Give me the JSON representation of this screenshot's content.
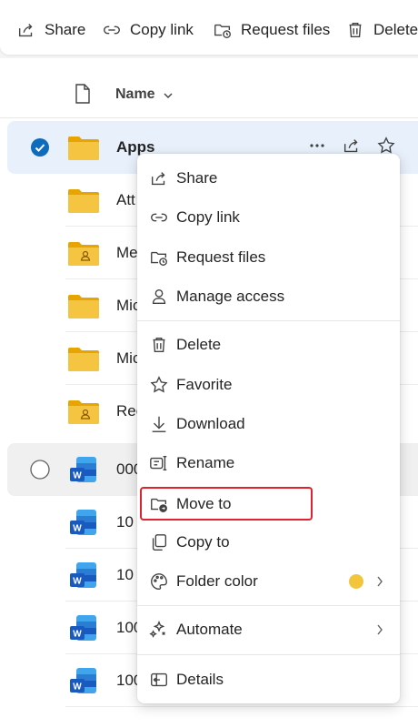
{
  "toolbar": {
    "items": [
      {
        "label": "Share",
        "icon": "share-icon"
      },
      {
        "label": "Copy link",
        "icon": "link-icon"
      },
      {
        "label": "Request files",
        "icon": "request-files-icon"
      },
      {
        "label": "Delete",
        "icon": "trash-icon"
      }
    ]
  },
  "list": {
    "header": {
      "name_label": "Name"
    },
    "rows": [
      {
        "name": "Apps",
        "type": "folder",
        "selected": true
      },
      {
        "name": "Att",
        "type": "folder"
      },
      {
        "name": "Me",
        "type": "shared-folder"
      },
      {
        "name": "Mic",
        "type": "folder"
      },
      {
        "name": "Mic",
        "type": "folder"
      },
      {
        "name": "Rec",
        "type": "shared-folder"
      },
      {
        "name": "000",
        "type": "word"
      },
      {
        "name": "10",
        "type": "word"
      },
      {
        "name": "10",
        "type": "word"
      },
      {
        "name": "100",
        "type": "word"
      },
      {
        "name": "100",
        "type": "word"
      }
    ]
  },
  "context_menu": {
    "items": [
      {
        "label": "Share",
        "icon": "share-icon"
      },
      {
        "label": "Copy link",
        "icon": "link-icon"
      },
      {
        "label": "Request files",
        "icon": "request-files-icon"
      },
      {
        "label": "Manage access",
        "icon": "person-icon"
      },
      {
        "label": "Delete",
        "icon": "trash-icon"
      },
      {
        "label": "Favorite",
        "icon": "star-icon"
      },
      {
        "label": "Download",
        "icon": "download-icon"
      },
      {
        "label": "Rename",
        "icon": "rename-icon"
      },
      {
        "label": "Move to",
        "icon": "move-to-icon",
        "highlighted": true
      },
      {
        "label": "Copy to",
        "icon": "copy-icon"
      },
      {
        "label": "Folder color",
        "icon": "palette-icon",
        "swatch_color": "#f2c53d"
      },
      {
        "label": "Automate",
        "icon": "automate-icon"
      },
      {
        "label": "Details",
        "icon": "details-icon"
      }
    ]
  },
  "colors": {
    "accent": "#0f6cbd",
    "folder": "#f5c542",
    "highlight_border": "#e0212e",
    "selected_row": "#e8f0fb"
  }
}
